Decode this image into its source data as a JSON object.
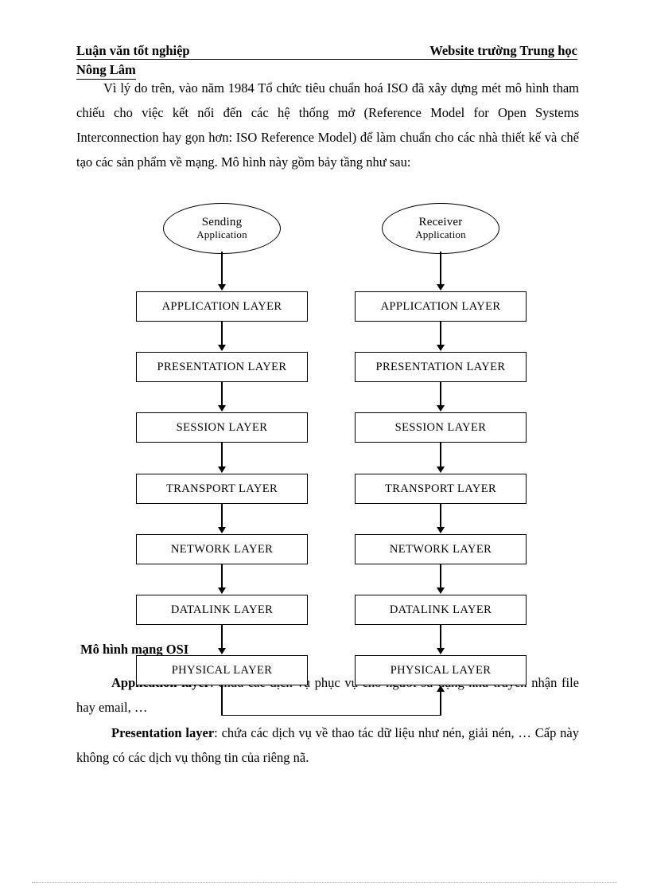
{
  "header": {
    "left": "Luận văn tốt nghiệp",
    "right": "Website trường Trung học",
    "second_line": "Nông Lâm"
  },
  "body": {
    "intro": "Vì lý do trên, vào năm 1984 Tổ chức tiêu chuẩn hoá ISO đã xây dựng mét mô hình tham chiếu cho việc kết nối đến các hệ thống mở (Reference Model for Open Systems Interconnection hay gọn hơn: ISO Reference Model) để làm chuẩn cho các nhà thiết kế và chế tạo các sản phẩm về mạng. Mô hình này gồm bảy tầng như sau:",
    "application_layer_bold": "Application layer",
    "application_layer_text": ": chứa các dịch vụ phục vụ cho người sử dụng như truyền nhận file hay email, …",
    "presentation_layer_bold": "Presentation layer",
    "presentation_layer_text": ": chứa các dịch vụ về thao tác dữ liệu như nén, giải nén, … Cấp này không có các dịch vụ thông tin của riêng nã."
  },
  "figure": {
    "caption": "Mô hình mạng OSI",
    "sending_node": {
      "title": "Sending",
      "subtitle": "Application"
    },
    "receiver_node": {
      "title": "Receiver",
      "subtitle": "Application"
    },
    "layers_left": [
      "APPLICATION LAYER",
      "PRESENTATION LAYER",
      "SESSION LAYER",
      "TRANSPORT LAYER",
      "NETWORK LAYER",
      "DATALINK LAYER",
      "PHYSICAL LAYER"
    ],
    "layers_right": [
      "APPLICATION LAYER",
      "PRESENTATION LAYER",
      "SESSION LAYER",
      "TRANSPORT LAYER",
      "NETWORK LAYER",
      "DATALINK LAYER",
      "PHYSICAL LAYER"
    ]
  },
  "colors": {
    "ink": "#000000",
    "paper": "#ffffff",
    "rule": "#b8b8b8"
  }
}
